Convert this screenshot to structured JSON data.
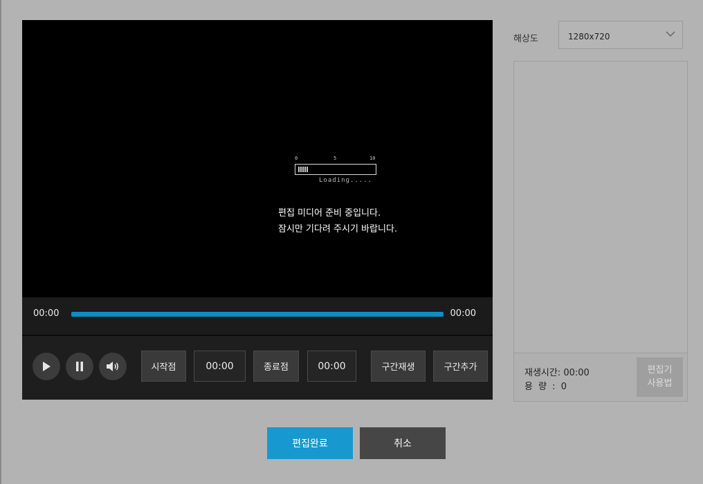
{
  "player": {
    "loader": {
      "scale": [
        "0",
        "5",
        "10"
      ],
      "text": "Loading....."
    },
    "message": {
      "line1": "편집 미디어 준비 중입니다.",
      "line2": "잠시만 기다려 주시기 바랍니다."
    },
    "progress": {
      "current_time": "00:00",
      "total_time": "00:00"
    },
    "controls": {
      "icons": [
        "play-icon",
        "pause-icon",
        "volume-icon"
      ],
      "start_point_label": "시작점",
      "start_time": "00:00",
      "end_point_label": "종료점",
      "end_time": "00:00",
      "section_play_label": "구간재생",
      "section_add_label": "구간추가"
    }
  },
  "resolution": {
    "label": "해상도",
    "selected": "1280x720"
  },
  "info": {
    "play_time": "재생시간: 00:00",
    "size": "용 량 : 0",
    "help_button": "편집기\n사용법"
  },
  "actions": {
    "done_label": "편집완료",
    "cancel_label": "취소"
  },
  "colors": {
    "accent": "#1799d0",
    "progress": "#0b8fc4"
  }
}
